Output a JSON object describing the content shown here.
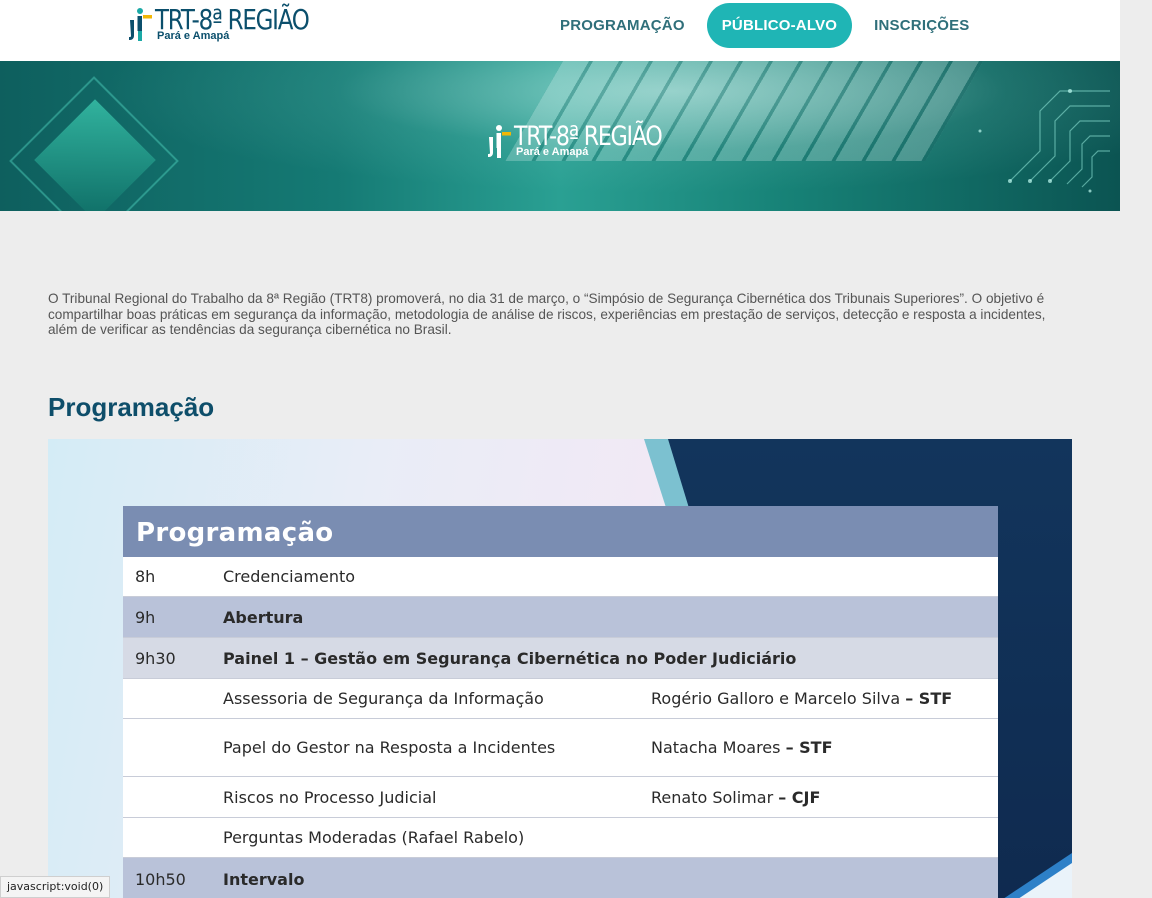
{
  "header": {
    "logo": {
      "name": "TRT-8ª REGIÃO",
      "sub": "Pará e Amapá"
    },
    "nav": [
      {
        "label": "PROGRAMAÇÃO",
        "active": false
      },
      {
        "label": "PÚBLICO-ALVO",
        "active": true
      },
      {
        "label": "INSCRIÇÕES",
        "active": false
      }
    ]
  },
  "banner": {
    "logo": {
      "name": "TRT-8ª REGIÃO",
      "sub": "Pará e Amapá"
    }
  },
  "intro": "O Tribunal Regional do Trabalho da 8ª Região (TRT8) promoverá, no dia 31 de março, o “Simpósio de Segurança Cibernética dos Tribunais Superiores”. O objetivo é compartilhar boas práticas em segurança da informação, metodologia de análise de riscos, experiências em prestação de serviços, detecção e resposta a incidentes, além de verificar as tendências da segurança cibernética no Brasil.",
  "section_title": "Programação",
  "schedule": {
    "heading": "Programação",
    "rows": [
      {
        "time": "8h",
        "title": "Credenciamento",
        "speaker": "",
        "org": ""
      },
      {
        "time": "9h",
        "title": "Abertura",
        "speaker": "",
        "org": ""
      },
      {
        "time": "9h30",
        "title": "Painel 1 – Gestão em Segurança Cibernética no Poder Judiciário",
        "speaker": "",
        "org": ""
      },
      {
        "time": "",
        "title": "Assessoria de Segurança da Informação",
        "speaker": "Rogério Galloro e Marcelo Silva",
        "org": "– STF"
      },
      {
        "time": "",
        "title": "Papel do Gestor na Resposta a Incidentes",
        "speaker": "Natacha Moares",
        "org": "– STF"
      },
      {
        "time": "",
        "title": "Riscos no Processo Judicial",
        "speaker": "Renato Solimar",
        "org": "– CJF"
      },
      {
        "time": "",
        "title": "Perguntas Moderadas (Rafael Rabelo)",
        "speaker": "",
        "org": ""
      },
      {
        "time": "10h50",
        "title": "Intervalo",
        "speaker": "",
        "org": ""
      }
    ]
  },
  "statusbar": "javascript:void(0)",
  "colors": {
    "accent": "#1fb5b5",
    "nav_text": "#2f6f7a",
    "title": "#0e4e6a",
    "table_header": "#7a8db2"
  }
}
